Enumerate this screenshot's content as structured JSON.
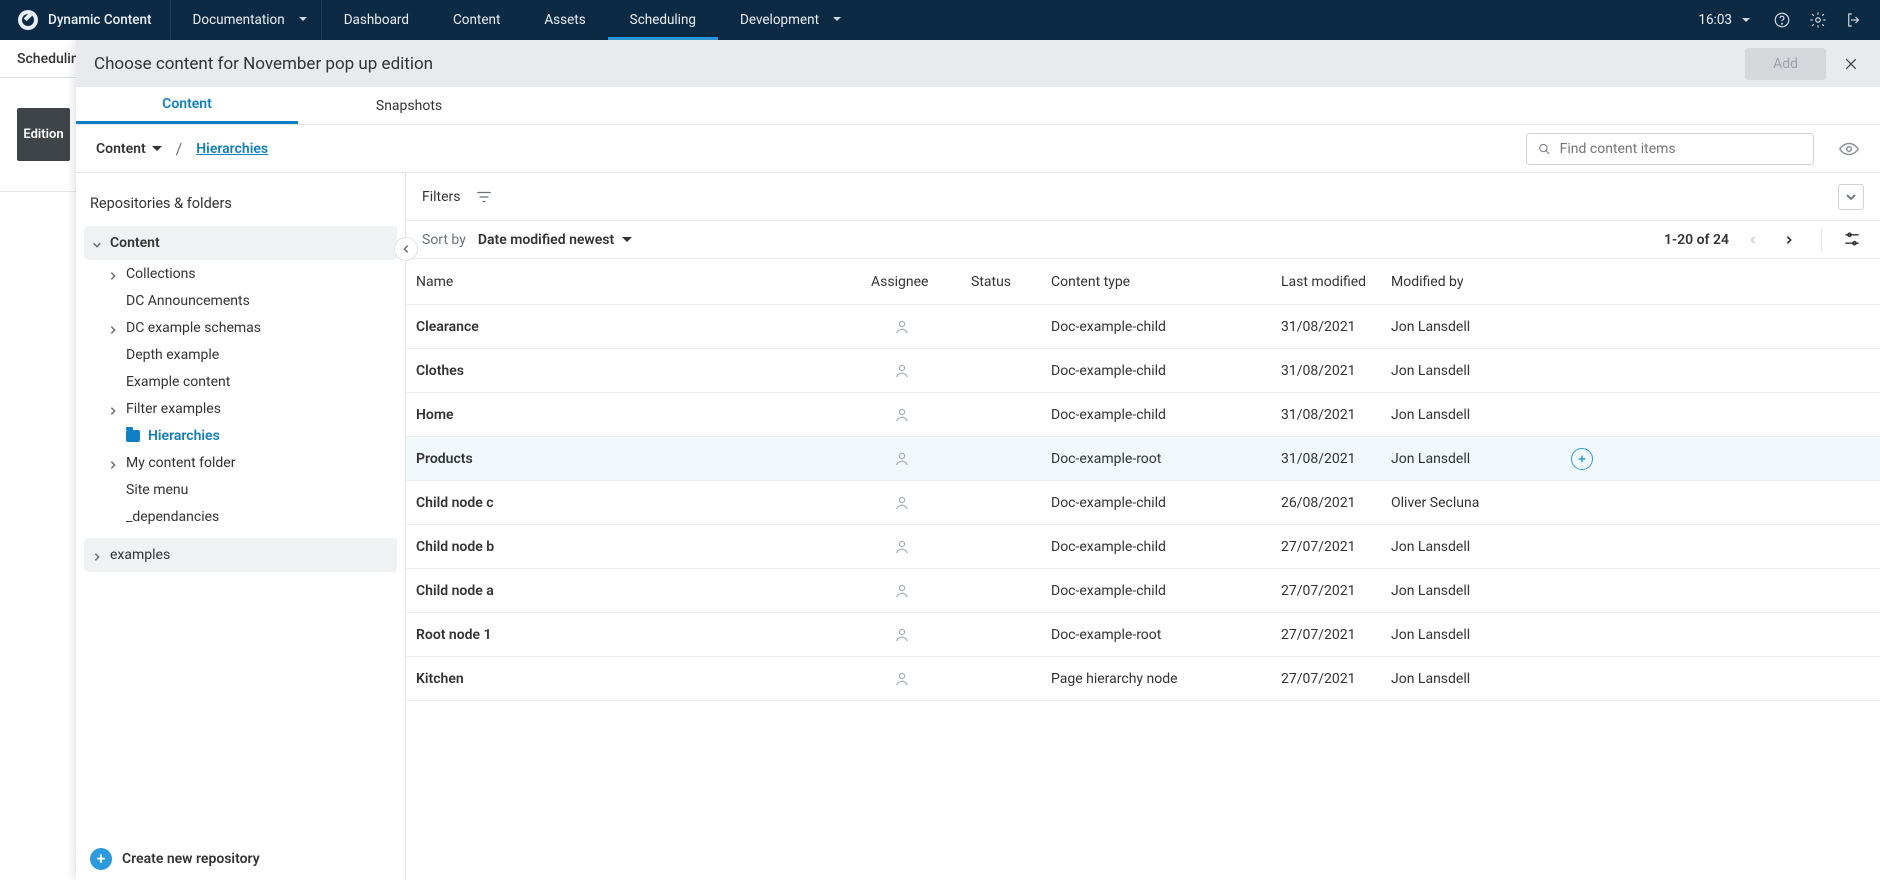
{
  "topbar": {
    "brand": "Dynamic Content",
    "nav": {
      "documentation": "Documentation",
      "dashboard": "Dashboard",
      "content": "Content",
      "assets": "Assets",
      "scheduling": "Scheduling",
      "development": "Development"
    },
    "time": "16:03"
  },
  "underlay": {
    "title": "Schedulin",
    "card": "Edition"
  },
  "modal": {
    "title": "Choose content for November pop up edition",
    "add_label": "Add",
    "tabs": {
      "content": "Content",
      "snapshots": "Snapshots"
    },
    "breadcrumb": {
      "root": "Content",
      "sep": "/",
      "current": "Hierarchies"
    },
    "search_placeholder": "Find content items"
  },
  "left": {
    "title": "Repositories & folders",
    "root": "Content",
    "items": [
      {
        "label": "Collections",
        "expandable": true
      },
      {
        "label": "DC Announcements",
        "expandable": false
      },
      {
        "label": "DC example schemas",
        "expandable": true
      },
      {
        "label": "Depth example",
        "expandable": false
      },
      {
        "label": "Example content",
        "expandable": false
      },
      {
        "label": "Filter examples",
        "expandable": true
      },
      {
        "label": "Hierarchies",
        "expandable": false,
        "active": true
      },
      {
        "label": "My content folder",
        "expandable": true
      },
      {
        "label": "Site menu",
        "expandable": false
      },
      {
        "label": "_dependancies",
        "expandable": false
      }
    ],
    "examples": "examples",
    "create": "Create new repository"
  },
  "right": {
    "filters_label": "Filters",
    "sort_label": "Sort by",
    "sort_value": "Date modified newest",
    "pager": "1-20 of 24",
    "columns": {
      "name": "Name",
      "assignee": "Assignee",
      "status": "Status",
      "type": "Content type",
      "modified": "Last modified",
      "by": "Modified by"
    },
    "rows": [
      {
        "name": "Clearance",
        "type": "Doc-example-child",
        "modified": "31/08/2021",
        "by": "Jon Lansdell"
      },
      {
        "name": "Clothes",
        "type": "Doc-example-child",
        "modified": "31/08/2021",
        "by": "Jon Lansdell"
      },
      {
        "name": "Home",
        "type": "Doc-example-child",
        "modified": "31/08/2021",
        "by": "Jon Lansdell"
      },
      {
        "name": "Products",
        "type": "Doc-example-root",
        "modified": "31/08/2021",
        "by": "Jon Lansdell",
        "hover": true
      },
      {
        "name": "Child node c",
        "type": "Doc-example-child",
        "modified": "26/08/2021",
        "by": "Oliver Secluna"
      },
      {
        "name": "Child node b",
        "type": "Doc-example-child",
        "modified": "27/07/2021",
        "by": "Jon Lansdell"
      },
      {
        "name": "Child node a",
        "type": "Doc-example-child",
        "modified": "27/07/2021",
        "by": "Jon Lansdell"
      },
      {
        "name": "Root node 1",
        "type": "Doc-example-root",
        "modified": "27/07/2021",
        "by": "Jon Lansdell"
      },
      {
        "name": "Kitchen",
        "type": "Page hierarchy node",
        "modified": "27/07/2021",
        "by": "Jon Lansdell"
      }
    ]
  }
}
